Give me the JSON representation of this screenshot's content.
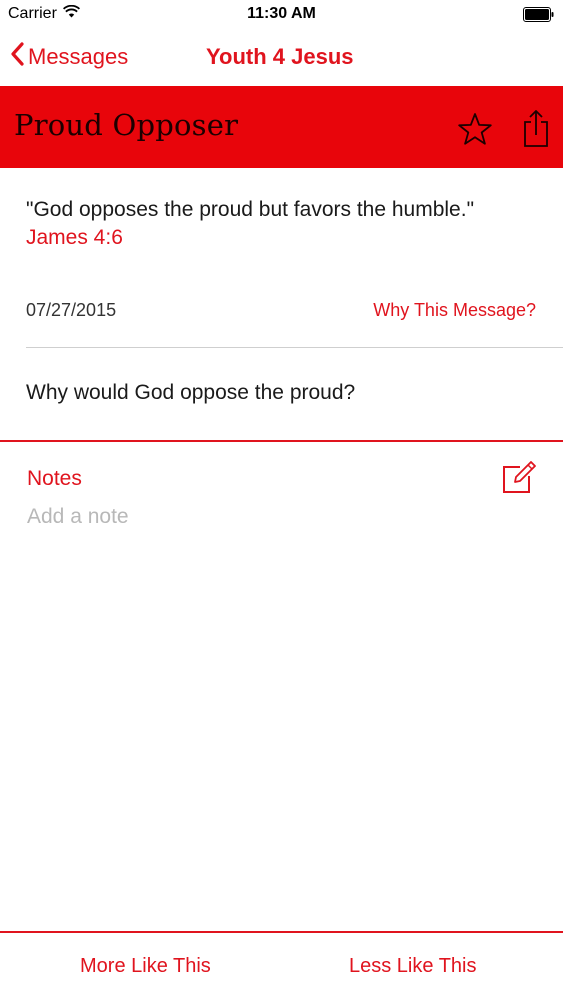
{
  "status_bar": {
    "carrier": "Carrier",
    "time": "11:30 AM"
  },
  "nav": {
    "back_label": "Messages",
    "title": "Youth 4 Jesus"
  },
  "header": {
    "title": "Proud Opposer"
  },
  "message": {
    "quote": "\"God opposes the proud but favors the humble.\"",
    "reference": "James 4:6",
    "date": "07/27/2015",
    "why_link": "Why This Message?",
    "question": "Why would God oppose the proud?"
  },
  "notes": {
    "label": "Notes",
    "placeholder": "Add a note",
    "value": ""
  },
  "bottom_bar": {
    "more_label": "More Like This",
    "less_label": "Less Like This"
  },
  "icons": {
    "back": "chevron-left-icon",
    "star": "star-icon",
    "share": "share-icon",
    "edit": "compose-icon",
    "wifi": "wifi-icon",
    "battery": "battery-icon"
  },
  "colors": {
    "accent": "#e0141e",
    "banner": "#e8050b",
    "banner_text": "#1c0000",
    "placeholder": "#b8b8b8",
    "divider": "#cfcfcf"
  }
}
